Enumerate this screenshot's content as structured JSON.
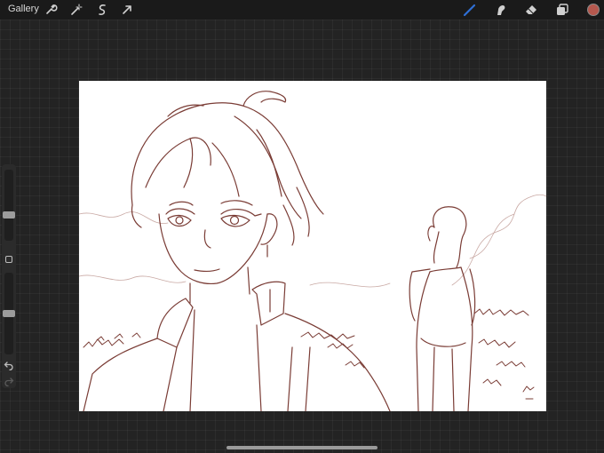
{
  "toolbar": {
    "gallery_label": "Gallery",
    "left_tools": [
      "wrench-icon",
      "magic-wand-icon",
      "selection-icon",
      "transform-icon"
    ],
    "right_tools": [
      "brush-icon",
      "smudge-icon",
      "eraser-icon",
      "layers-icon"
    ],
    "active_tool": "brush-icon",
    "current_color": "#b5584e"
  },
  "sidebar": {
    "brush_size_level": 0.35,
    "brush_opacity_level": 0.5
  },
  "colors": {
    "ink": "#7a3c35",
    "accent": "#2f6fd6"
  }
}
